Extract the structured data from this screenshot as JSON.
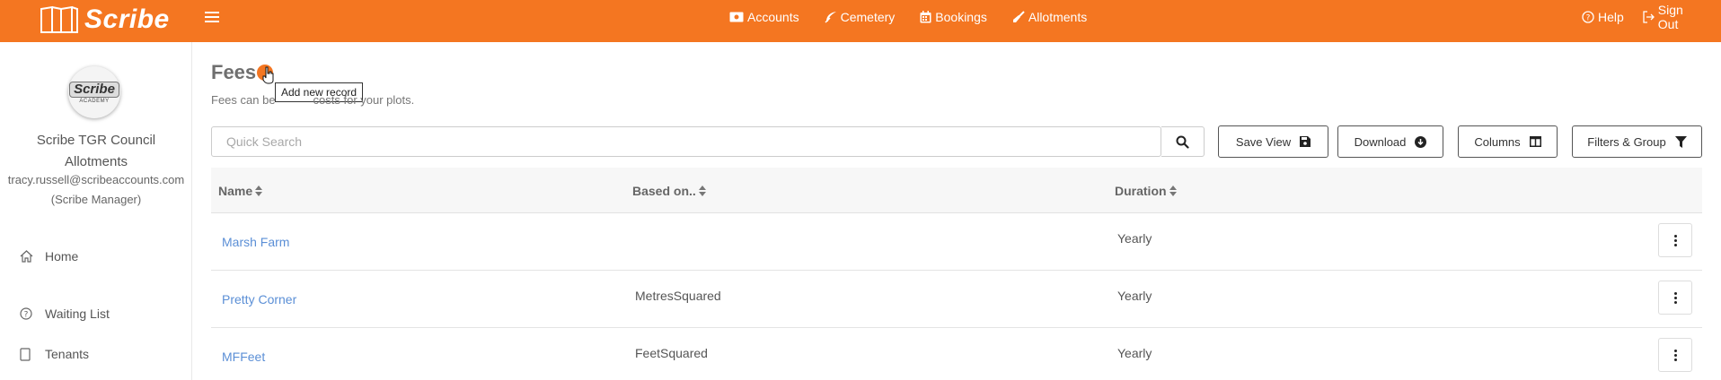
{
  "header": {
    "brand": "Scribe",
    "nav": [
      {
        "label": "Accounts",
        "icon": "accounts-icon"
      },
      {
        "label": "Cemetery",
        "icon": "feather-icon"
      },
      {
        "label": "Bookings",
        "icon": "calendar-icon"
      },
      {
        "label": "Allotments",
        "icon": "shovel-icon"
      }
    ],
    "help_label": "Help",
    "signout_label": "Sign Out",
    "accent_color": "#f47621"
  },
  "sidebar": {
    "avatar_logo": "Scribe",
    "avatar_sub": "ACADEMY",
    "org_line1": "Scribe TGR Council",
    "org_line2": "Allotments",
    "email": "tracy.russell@scribeaccounts.com",
    "role": "(Scribe Manager)",
    "items": [
      {
        "label": "Home",
        "icon": "home-icon"
      },
      {
        "label": "Waiting List",
        "icon": "question-circle-icon"
      },
      {
        "label": "Tenants",
        "icon": "tenants-icon"
      }
    ]
  },
  "main": {
    "title": "Fees",
    "add_tooltip": "Add new record",
    "subtitle_left": "Fees can be",
    "subtitle_right": "costs for your plots.",
    "search_placeholder": "Quick Search",
    "toolbar": {
      "save_view": "Save View",
      "download": "Download",
      "columns": "Columns",
      "filters": "Filters & Group"
    },
    "columns": [
      "Name",
      "Based on..",
      "Duration"
    ],
    "rows": [
      {
        "name": "Marsh Farm",
        "based_on": "",
        "duration": "Yearly"
      },
      {
        "name": "Pretty Corner",
        "based_on": "MetresSquared",
        "duration": "Yearly"
      },
      {
        "name": "MFFeet",
        "based_on": "FeetSquared",
        "duration": "Yearly"
      }
    ]
  }
}
